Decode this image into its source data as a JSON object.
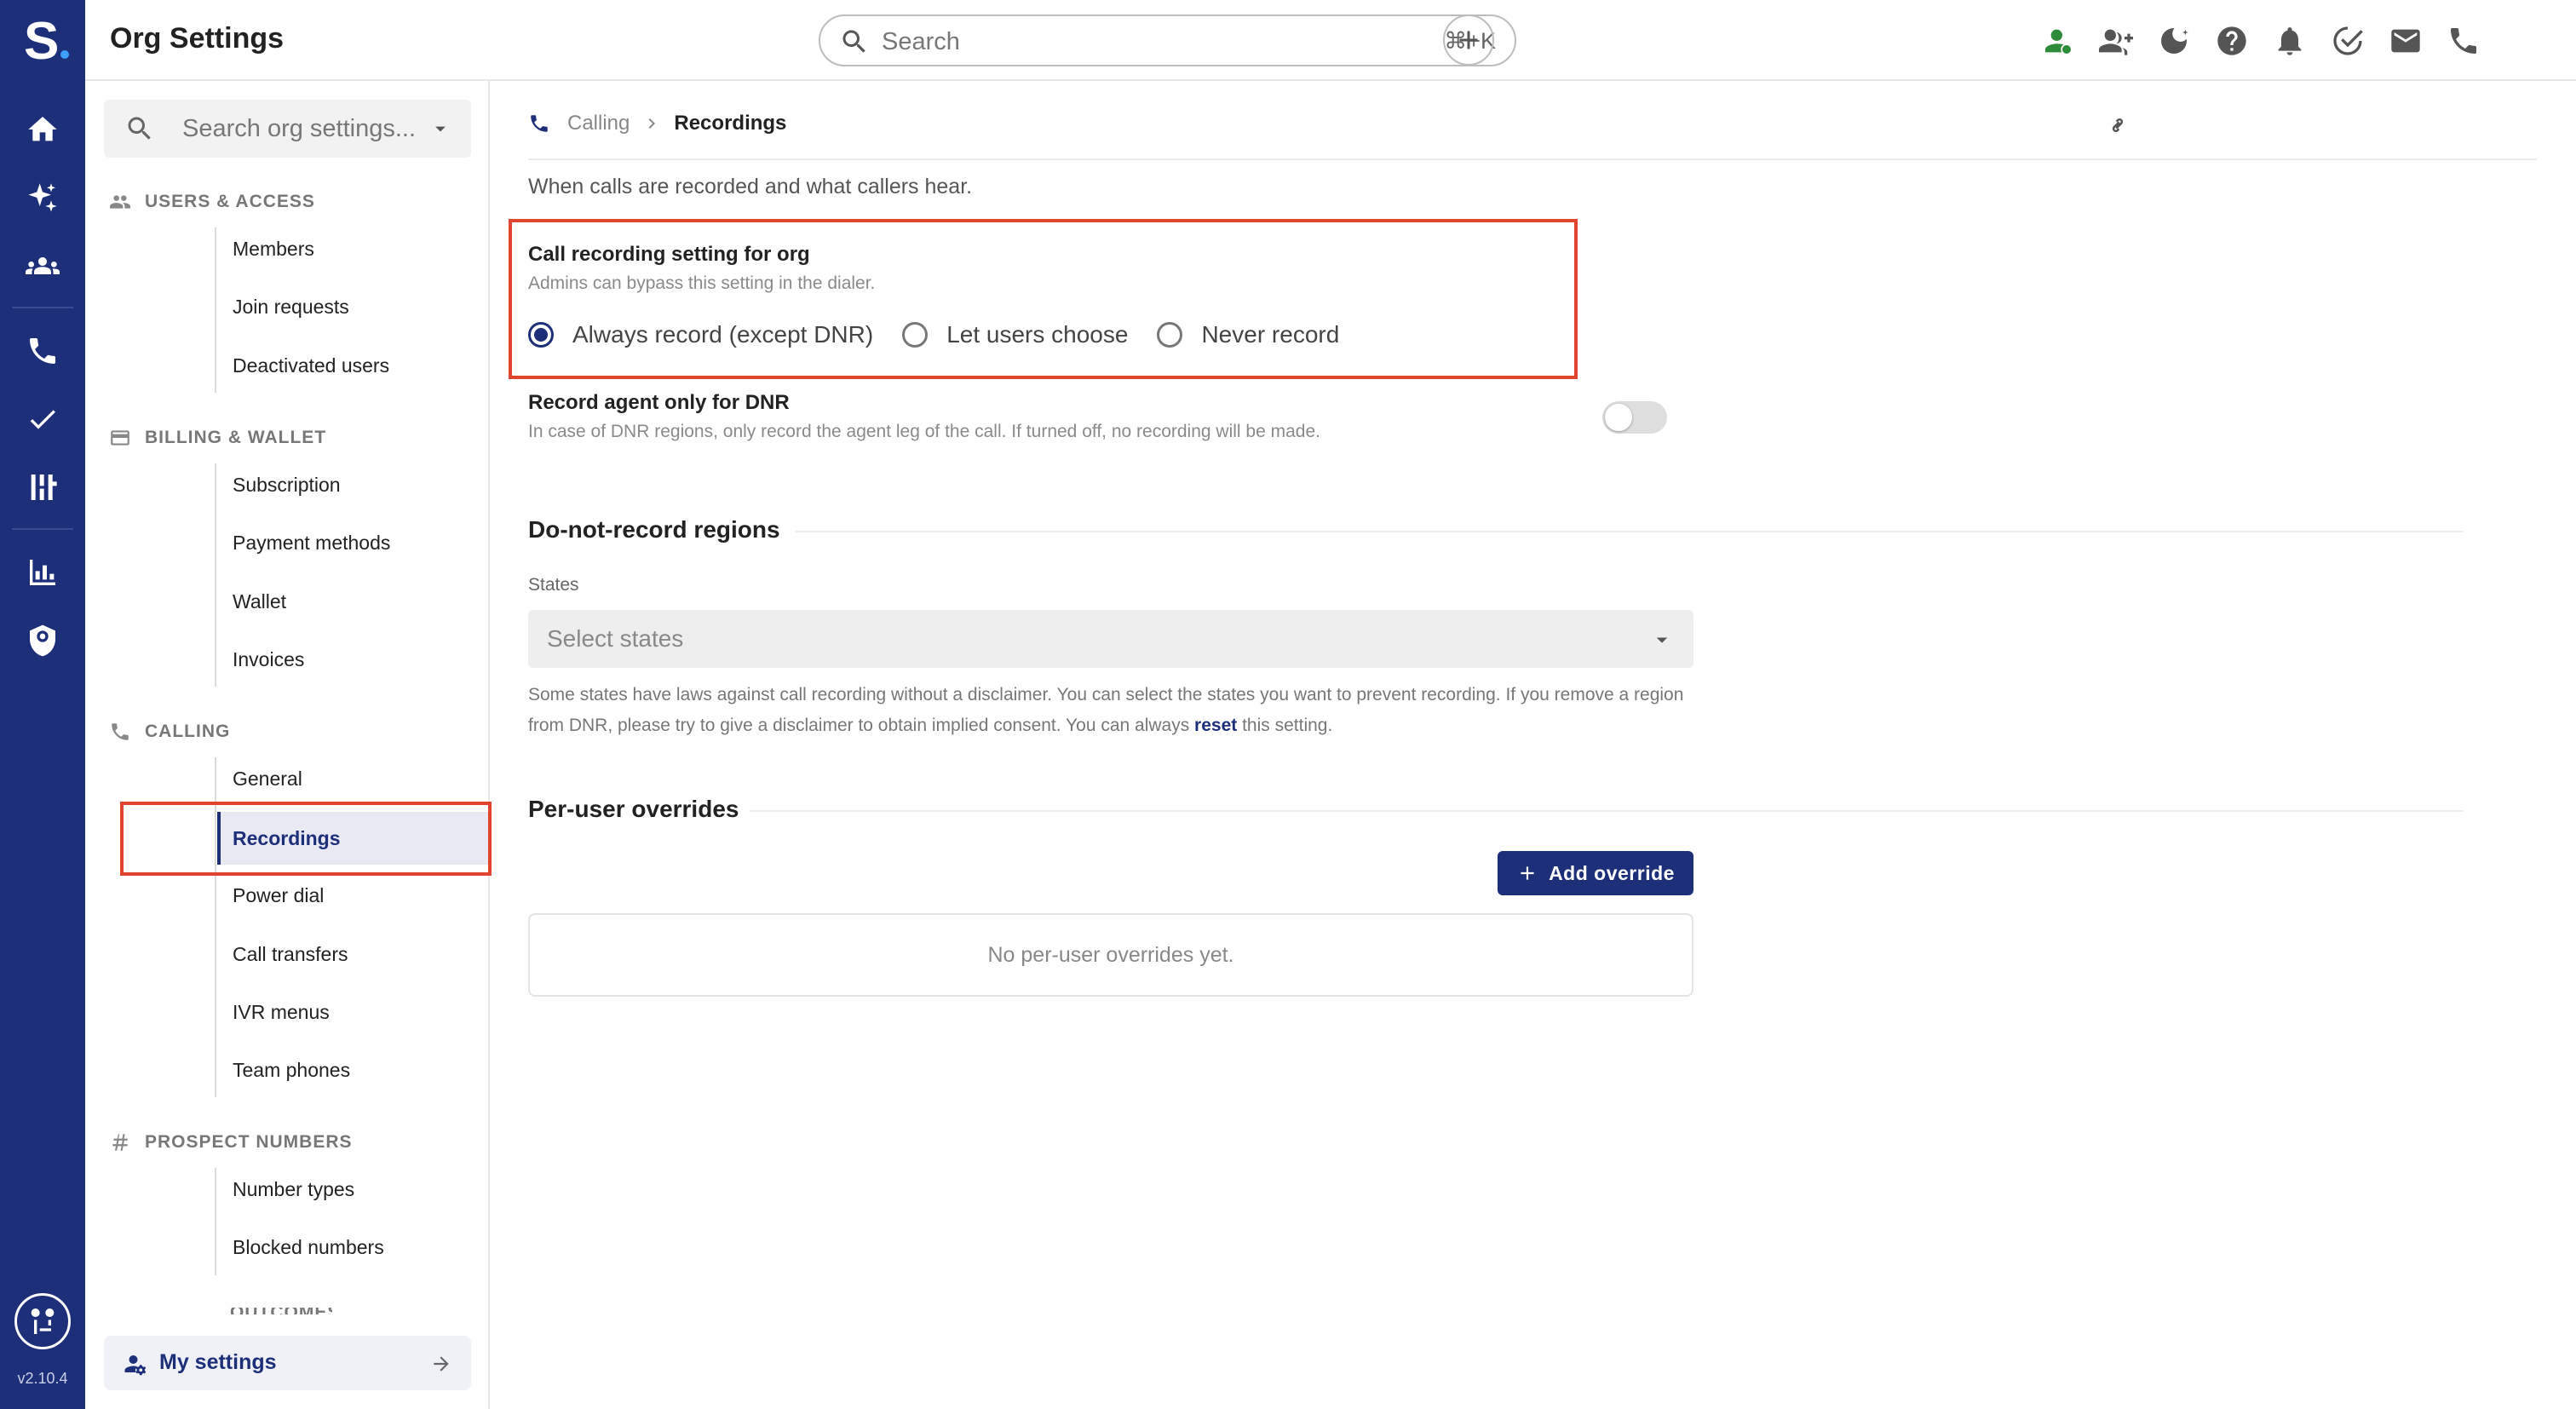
{
  "app": {
    "logo_text": "S",
    "version": "v2.10.4"
  },
  "rail": {
    "icons": [
      "home-icon",
      "sparkle-icon",
      "team-icon",
      "phone-icon",
      "check-icon",
      "sequence-icon",
      "bar-chart-icon",
      "shield-icon",
      "route-icon"
    ]
  },
  "topbar": {
    "title": "Org Settings",
    "search_placeholder": "Search",
    "search_shortcut": "⌘+K",
    "icons": [
      "user-status-icon",
      "add-team-icon",
      "do-not-disturb-icon",
      "help-icon",
      "bell-icon",
      "task-icon",
      "mail-icon",
      "phone-icon"
    ],
    "colors": {
      "status_green": "#2e8b3a"
    }
  },
  "sidebar": {
    "search_placeholder": "Search org settings...",
    "groups": [
      {
        "title": "USERS & ACCESS",
        "icon": "people-icon",
        "items": [
          "Members",
          "Join requests",
          "Deactivated users"
        ]
      },
      {
        "title": "BILLING & WALLET",
        "icon": "card-icon",
        "items": [
          "Subscription",
          "Payment methods",
          "Wallet",
          "Invoices"
        ]
      },
      {
        "title": "CALLING",
        "icon": "phone-icon",
        "items": [
          "General",
          "Recordings",
          "Power dial",
          "Call transfers",
          "IVR menus",
          "Team phones"
        ]
      },
      {
        "title": "PROSPECT NUMBERS",
        "icon": "hash-icon",
        "items": [
          "Number types",
          "Blocked numbers"
        ]
      }
    ],
    "partial_group": "OUTCOMES",
    "active_item": "Recordings",
    "my_settings": "My settings"
  },
  "main": {
    "breadcrumb": {
      "parent": "Calling",
      "current": "Recordings"
    },
    "description": "When calls are recorded and what callers hear.",
    "org_setting": {
      "label": "Call recording setting for org",
      "sub": "Admins can bypass this setting in the dialer.",
      "options": [
        "Always record (except DNR)",
        "Let users choose",
        "Never record"
      ],
      "selected": "Always record (except DNR)"
    },
    "agent_only": {
      "label": "Record agent only for DNR",
      "sub": "In case of DNR regions, only record the agent leg of the call. If turned off, no recording will be made.",
      "enabled": false
    },
    "dnr": {
      "heading": "Do-not-record regions",
      "field_label": "States",
      "placeholder": "Select states",
      "help_before": "Some states have laws against call recording without a disclaimer. You can select the states you want to prevent recording. If you remove a region from DNR, please try to give a disclaimer to obtain implied consent. You can always ",
      "help_link": "reset",
      "help_after": " this setting."
    },
    "overrides": {
      "heading": "Per-user overrides",
      "add_label": "Add override",
      "empty": "No per-user overrides yet."
    }
  },
  "colors": {
    "brand": "#1e2f7a",
    "highlight": "#e0442e"
  }
}
